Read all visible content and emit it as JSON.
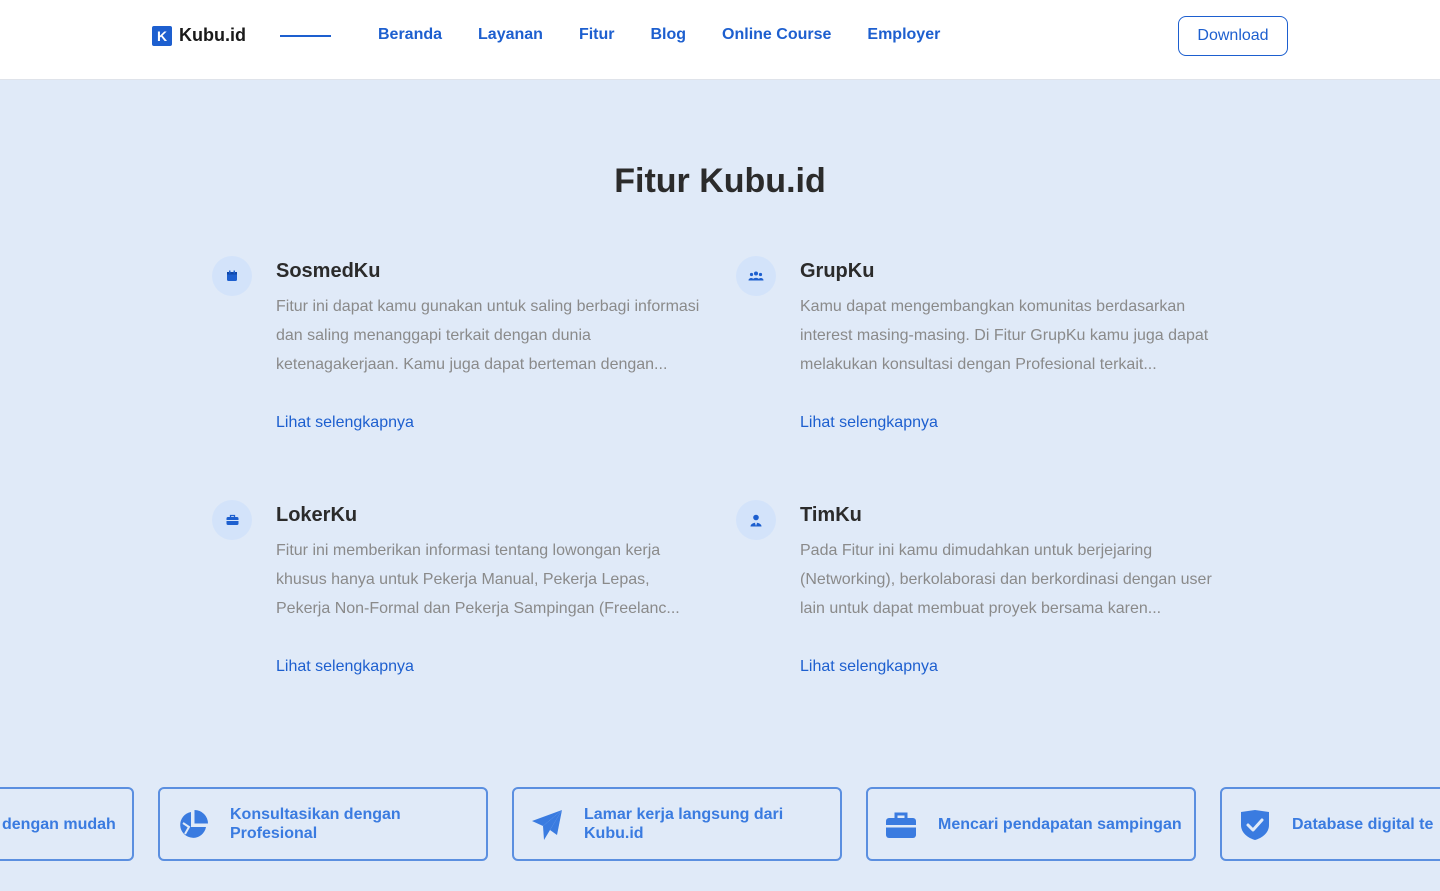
{
  "header": {
    "logo_mark": "K",
    "logo_text": "Kubu.id",
    "nav": [
      "Beranda",
      "Layanan",
      "Fitur",
      "Blog",
      "Online Course",
      "Employer"
    ],
    "download_label": "Download"
  },
  "section": {
    "title": "Fitur Kubu.id"
  },
  "features": [
    {
      "icon": "calendar-icon",
      "title": "SosmedKu",
      "desc": "Fitur ini dapat kamu gunakan untuk saling berbagi informasi dan saling menanggapi terkait dengan dunia ketenagakerjaan. Kamu juga dapat berteman dengan...",
      "link": "Lihat selengkapnya"
    },
    {
      "icon": "group-icon",
      "title": "GrupKu",
      "desc": "Kamu dapat mengembangkan komunitas berdasarkan interest masing-masing. Di Fitur GrupKu kamu juga dapat melakukan konsultasi dengan Profesional terkait...",
      "link": "Lihat selengkapnya"
    },
    {
      "icon": "briefcase-icon",
      "title": "LokerKu",
      "desc": "Fitur ini memberikan informasi tentang lowongan kerja khusus hanya untuk Pekerja Manual, Pekerja Lepas, Pekerja Non-Formal dan Pekerja Sampingan (Freelanc...",
      "link": "Lihat selengkapnya"
    },
    {
      "icon": "user-tie-icon",
      "title": "TimKu",
      "desc": "Pada Fitur ini kamu dimudahkan untuk berjejaring (Networking), berkolaborasi dan berkordinasi dengan user lain untuk dapat membuat proyek bersama karen...",
      "link": "Lihat selengkapnya"
    }
  ],
  "highlights": [
    {
      "icon": "",
      "label": "dengan mudah"
    },
    {
      "icon": "pie-chart-icon",
      "label": "Konsultasikan dengan Profesional"
    },
    {
      "icon": "paper-plane-icon",
      "label": "Lamar kerja langsung dari Kubu.id"
    },
    {
      "icon": "briefcase-icon",
      "label": "Mencari pendapatan sampingan"
    },
    {
      "icon": "shield-check-icon",
      "label": "Database digital te"
    }
  ],
  "colors": {
    "accent": "#1d5fcf",
    "background": "#e0eaf8",
    "chip_border": "#5b8fe0",
    "chip_text": "#3a7be0",
    "icon_circle": "#d3e3fa"
  }
}
